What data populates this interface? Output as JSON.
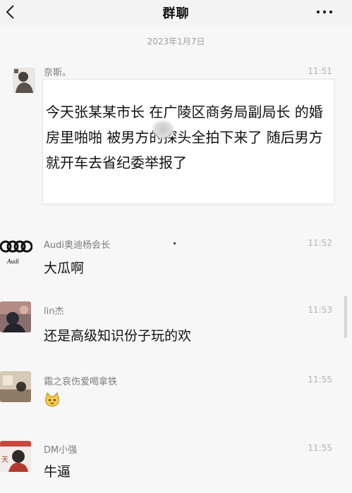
{
  "header": {
    "title": "群聊"
  },
  "date_divider": "2023年1月7日",
  "messages": [
    {
      "sender": "奈斯。",
      "time": "11:51",
      "text": "今天张某某市长 在广陵区商务局副局长 的婚房里啪啪 被男方的探头全拍下来了 随后男方就开车去省纪委举报了",
      "avatar_icon": "person-photo-icon"
    },
    {
      "sender": "Audi奥迪杨会长",
      "time": "11:52",
      "text": "大瓜啊",
      "avatar_icon": "audi-logo-icon",
      "avatar_caption": "Audi"
    },
    {
      "sender": "lin杰",
      "time": "11:53",
      "text": "还是高级知识份子玩的欢",
      "avatar_icon": "person-photo-icon"
    },
    {
      "sender": "霜之哀伤爱喝拿铁",
      "time": "11:55",
      "text": "",
      "sticker": "cat-face-sticker",
      "avatar_icon": "room-photo-icon"
    },
    {
      "sender": "DM小强",
      "time": "11:55",
      "text": "牛逼",
      "avatar_icon": "person-red-icon",
      "avatar_caption": "天"
    }
  ]
}
